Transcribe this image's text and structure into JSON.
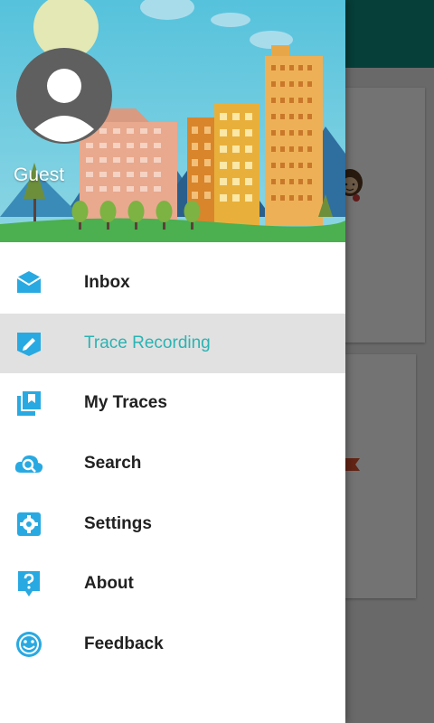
{
  "user": {
    "name": "Guest"
  },
  "menu": {
    "items": [
      {
        "label": "Inbox",
        "icon": "inbox-icon"
      },
      {
        "label": "Trace Recording",
        "icon": "edit-pencil-icon",
        "active": true
      },
      {
        "label": "My Traces",
        "icon": "bookmark-cards-icon"
      },
      {
        "label": "Search",
        "icon": "cloud-search-icon"
      },
      {
        "label": "Settings",
        "icon": "gear-icon"
      },
      {
        "label": "About",
        "icon": "question-bubble-icon"
      },
      {
        "label": "Feedback",
        "icon": "smiley-icon"
      }
    ]
  },
  "colors": {
    "accent": "#2bb3b3",
    "icon": "#29a9e1",
    "toolbar": "#0f8a7f",
    "active_row": "#e1e1e1"
  }
}
